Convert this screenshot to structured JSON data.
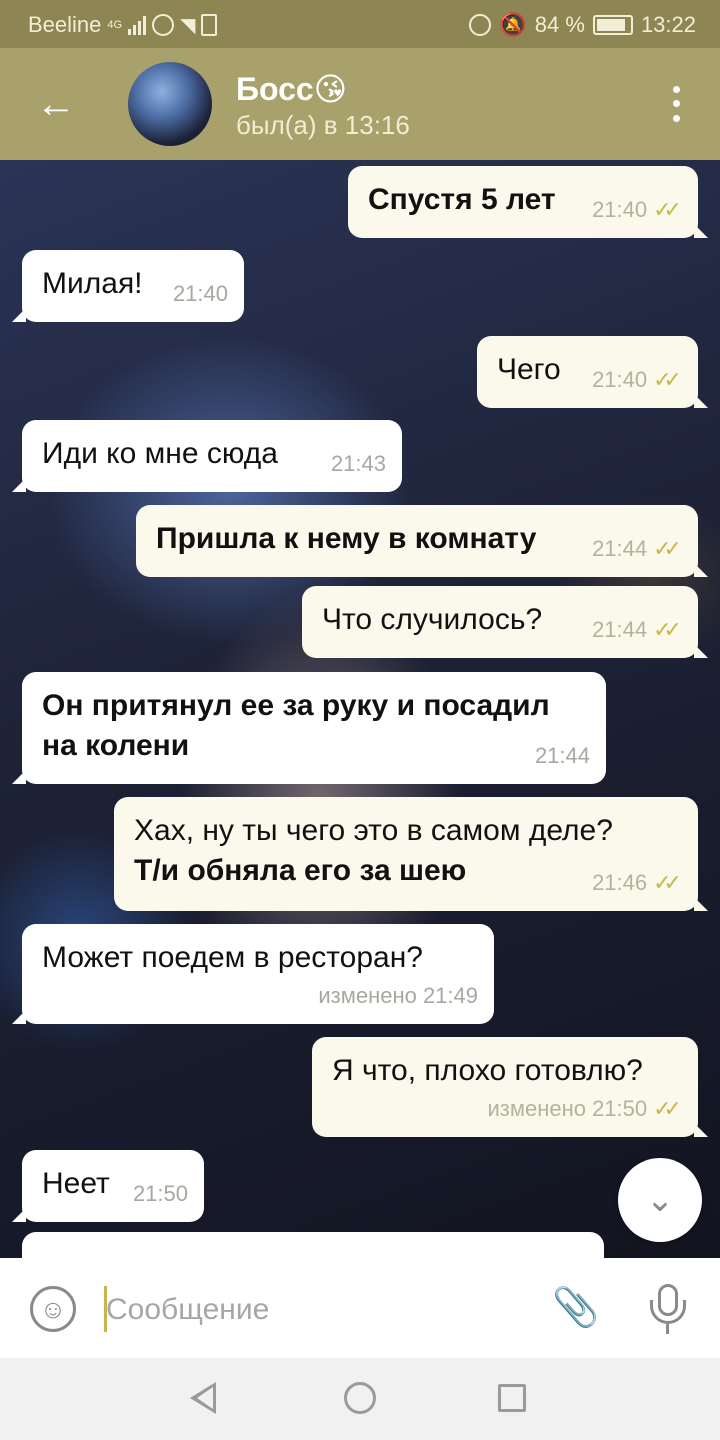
{
  "status_bar": {
    "carrier": "Beeline",
    "network": "4G",
    "battery": "84 %",
    "time": "13:22"
  },
  "header": {
    "back_icon": "arrow-left-icon",
    "contact_name": "Босс😘",
    "last_seen": "был(а) в 13:16",
    "menu_icon": "more-vertical-icon"
  },
  "messages": [
    {
      "direction": "out",
      "text": "Спустя 5 лет",
      "time": "21:40",
      "bold": true
    },
    {
      "direction": "in",
      "text": "Милая!",
      "time": "21:40",
      "bold": false
    },
    {
      "direction": "out",
      "text": "Чего",
      "time": "21:40",
      "bold": false
    },
    {
      "direction": "in",
      "text": "Иди ко мне сюда",
      "time": "21:43",
      "bold": false
    },
    {
      "direction": "out",
      "text": "Пришла к нему в комнату",
      "time": "21:44",
      "bold": true
    },
    {
      "direction": "out",
      "text": "Что случилось?",
      "time": "21:44",
      "bold": false
    },
    {
      "direction": "in",
      "text": "Он притянул ее за руку и посадил на колени",
      "time": "21:44",
      "bold": true
    },
    {
      "direction": "out",
      "text": "Хах, ну ты чего это в самом деле?",
      "text2": "Т/и обняла его за шею",
      "time": "21:46",
      "bold": false
    },
    {
      "direction": "in",
      "text": "Может поедем в ресторан?",
      "time": "изменено 21:49",
      "bold": false
    },
    {
      "direction": "out",
      "text": "Я что, плохо готовлю?",
      "time": "изменено 21:50",
      "bold": false
    },
    {
      "direction": "in",
      "text": "Неет",
      "time": "21:50",
      "bold": false
    }
  ],
  "ticks": "✓✓",
  "input": {
    "placeholder": "Сообщение",
    "emoji_icon": "smile-icon",
    "attach_icon": "paperclip-icon",
    "mic_icon": "microphone-icon"
  },
  "scroll_button_icon": "chevron-down-icon",
  "colors": {
    "header": "#a9a16b",
    "status_bar": "#8d8652",
    "outgoing_bubble": "#fbf8ec",
    "incoming_bubble": "#ffffff",
    "read_ticks": "#c7b94a"
  }
}
